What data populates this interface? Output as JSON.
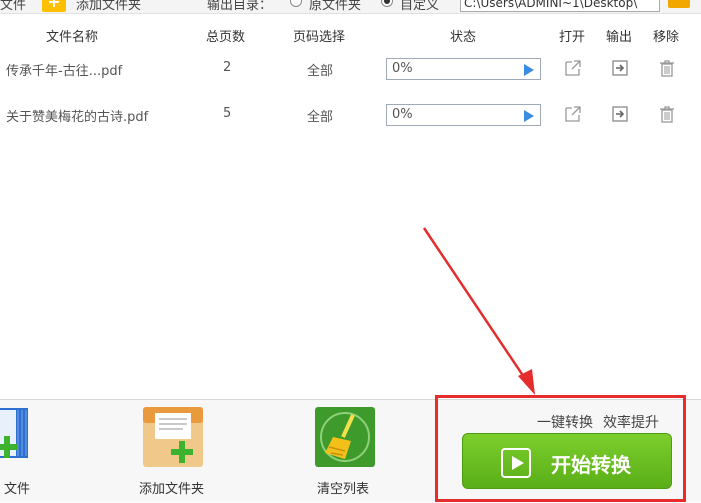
{
  "topbar": {
    "add_file_label": "文件",
    "add_folder_label": "添加文件夹",
    "output_dir_label": "输出目录：",
    "radio_original": "原文件夹",
    "radio_custom": "自定义",
    "output_path": "C:\\Users\\ADMINI~1\\Desktop\\"
  },
  "table": {
    "headers": {
      "name": "文件名称",
      "pages": "总页数",
      "range": "页码选择",
      "status": "状态",
      "open": "打开",
      "export": "输出",
      "remove": "移除"
    },
    "rows": [
      {
        "name": "传承千年-古往...pdf",
        "pages": "2",
        "range": "全部",
        "progress": "0%"
      },
      {
        "name": "关于赞美梅花的古诗.pdf",
        "pages": "5",
        "range": "全部",
        "progress": "0%"
      }
    ]
  },
  "bottom": {
    "add_file_label": "文件",
    "add_folder_label": "添加文件夹",
    "clear_label": "清空列表",
    "slogan_1": "一键转换",
    "slogan_2": "效率提升",
    "start_label": "开始转换"
  },
  "colors": {
    "start_green": "#6cc023",
    "highlight_red": "#e52d2d",
    "annotation_arrow": "#e52d2d",
    "progress_play": "#3a8de0"
  }
}
